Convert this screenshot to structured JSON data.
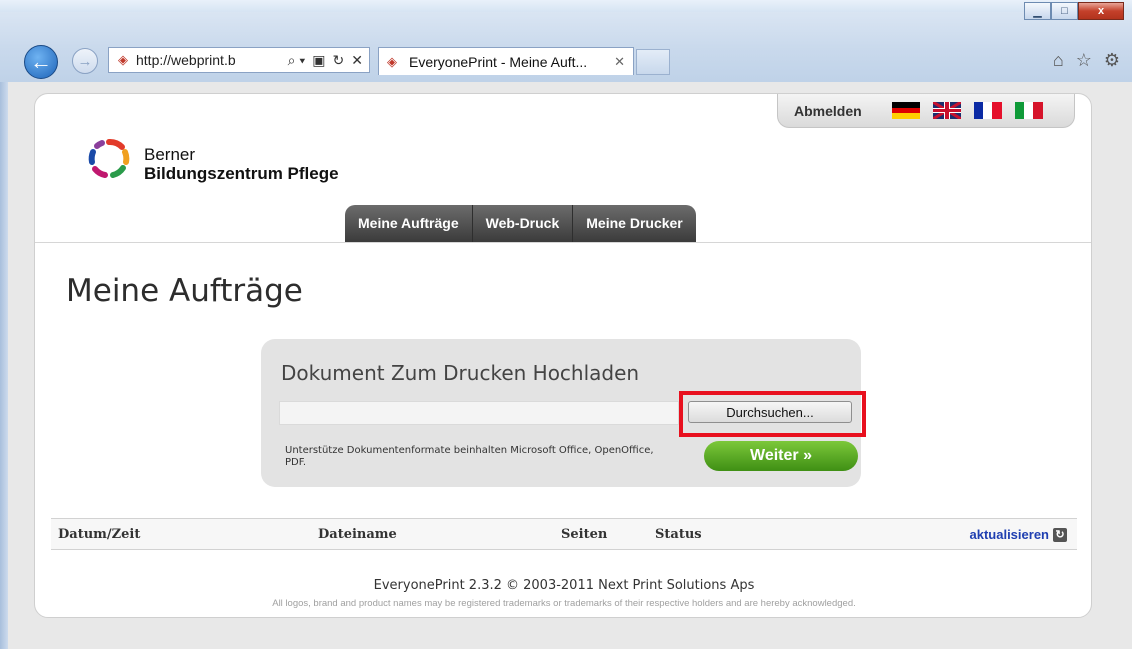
{
  "browser": {
    "url": "http://webprint.b",
    "tab_title": "EveryonePrint - Meine Auft...",
    "window_controls": {
      "minimize": "▁",
      "maximize": "□",
      "close": "x"
    },
    "addr_tools": [
      "⌕ ▾",
      "▣",
      "↻",
      "✕"
    ],
    "tab_close": "✕",
    "right_icons": [
      "⌂",
      "☆",
      "⚙"
    ]
  },
  "header": {
    "logout_label": "Abmelden",
    "languages": [
      "de",
      "en",
      "fr",
      "it"
    ],
    "brand_line1": "Berner",
    "brand_line2": "Bildungszentrum Pflege"
  },
  "nav": {
    "items": [
      "Meine Aufträge",
      "Web-Druck",
      "Meine Drucker"
    ]
  },
  "page": {
    "title": "Meine Aufträge"
  },
  "upload": {
    "title": "Dokument Zum Drucken Hochladen",
    "browse_label": "Durchsuchen...",
    "formats_text": "Unterstütze Dokumentenformate beinhalten Microsoft Office, OpenOffice, PDF.",
    "submit_label": "Weiter »",
    "highlight_color": "#e8101e"
  },
  "jobs_table": {
    "columns": [
      "Datum/Zeit",
      "Dateiname",
      "Seiten",
      "Status"
    ],
    "refresh_label": "aktualisieren",
    "rows": []
  },
  "footer": {
    "version": "EveryonePrint 2.3.2 © 2003-2011 Next Print Solutions Aps",
    "disclaimer": "All logos, brand and product names may be registered trademarks or trademarks of their respective holders and are hereby acknowledged."
  }
}
